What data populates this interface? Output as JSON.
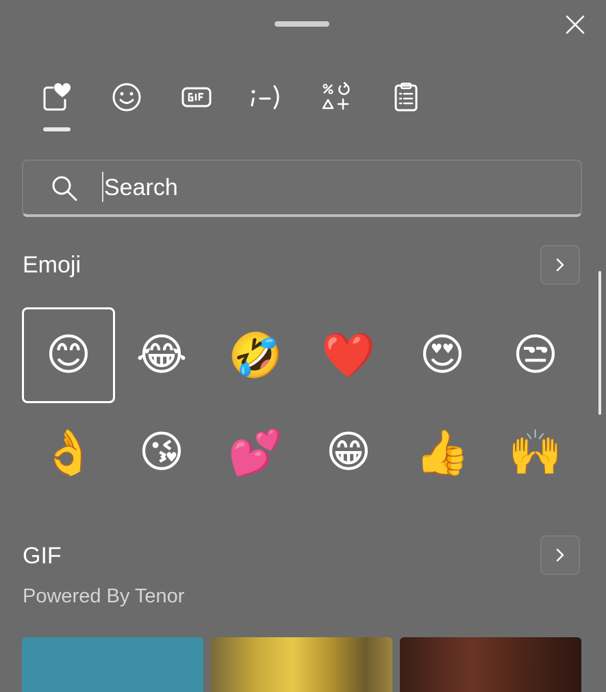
{
  "tabs": [
    {
      "icon": "favorites-heart-icon",
      "selected": true
    },
    {
      "icon": "smiley-icon"
    },
    {
      "icon": "gif-icon"
    },
    {
      "icon": "kaomoji-icon",
      "text": ";-)"
    },
    {
      "icon": "symbols-icon"
    },
    {
      "icon": "clipboard-icon"
    }
  ],
  "search": {
    "placeholder": "Search",
    "value": ""
  },
  "emoji_section": {
    "title": "Emoji",
    "items": [
      "😊",
      "😂",
      "🤣",
      "❤️",
      "😍",
      "😒",
      "👌",
      "😘",
      "💕",
      "😁",
      "👍",
      "🙌"
    ],
    "selected_index": 0
  },
  "gif_section": {
    "title": "GIF",
    "subtitle": "Powered By Tenor"
  },
  "colors": {
    "background": "#6b6b6b",
    "text": "#ffffff",
    "muted": "#d5d5d5"
  }
}
